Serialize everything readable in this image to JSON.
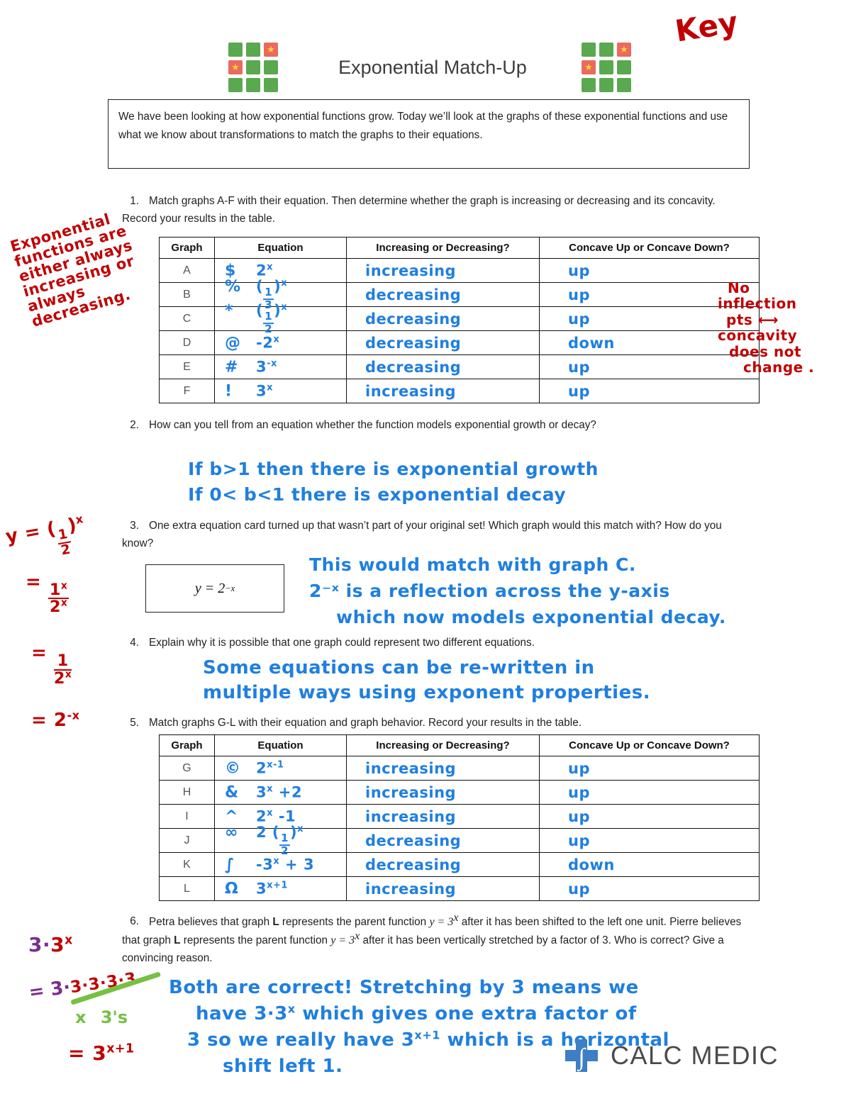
{
  "header": {
    "title": "Exponential Match-Up",
    "key_mark": "Key",
    "logo_icon_name": "match-tiles-logo",
    "star_glyph": "★"
  },
  "intro": {
    "text": "We have been looking at how exponential functions grow. Today we’ll look at the graphs of these exponential functions and use what we know about transformations to match the graphs to their equations."
  },
  "questions": {
    "q1": {
      "number": "1.",
      "text": "Match graphs A-F with their equation. Then determine whether the graph is increasing or decreasing and its concavity. Record your results in the table."
    },
    "q2": {
      "number": "2.",
      "text": "How can you tell from an equation whether the function models exponential growth or decay?",
      "answer_line1": "If b>1 then there is exponential growth",
      "answer_line2": "If 0< b<1 there is exponential decay"
    },
    "q3": {
      "number": "3.",
      "text": "One extra equation card turned up that wasn’t part of your original set! Which graph would this match with? How do you know?",
      "card_equation": "y = 2",
      "card_exponent": "−x",
      "answer_line1": "This would match with graph C.",
      "answer_line2": "2⁻ˣ is a reflection across the y-axis",
      "answer_line3": "which now models exponential decay."
    },
    "q4": {
      "number": "4.",
      "text": "Explain why it is possible that one graph could represent two different equations.",
      "answer_line1": "Some equations can be re-written in",
      "answer_line2": "multiple ways using exponent properties."
    },
    "q5": {
      "number": "5.",
      "text": "Match graphs G-L with their equation and graph behavior. Record your results in the table."
    },
    "q6": {
      "number": "6.",
      "text_a": "Petra believes that graph ",
      "text_b": "L",
      "text_c": " represents the parent function ",
      "text_d": "y = 3",
      "text_e": "x",
      "text_f": " after it has been shifted to the left one unit. Pierre believes that graph ",
      "text_g": "L",
      "text_h": " represents the parent function ",
      "text_i": "y = 3",
      "text_j": "x",
      "text_k": " after it has been vertically stretched by a factor of 3. Who is correct? Give a convincing reason.",
      "answer_line1": "Both are correct! Stretching by 3 means we",
      "answer_line2a": "have   3·3",
      "answer_line2b": "x",
      "answer_line2c": "  which gives one extra factor of",
      "answer_line3a": "3 so we really have  3",
      "answer_line3b": "x+1",
      "answer_line3c": " which is a horizontal",
      "answer_line4": "shift left 1."
    }
  },
  "table1": {
    "headers": [
      "Graph",
      "Equation",
      "Increasing or Decreasing?",
      "Concave Up or Concave Down?"
    ],
    "rows": [
      {
        "graph": "A",
        "eq_symbol": "$",
        "eq_base": "2",
        "eq_sup": "x",
        "eq_frac": null,
        "increasing": "increasing",
        "concavity": "up"
      },
      {
        "graph": "B",
        "eq_symbol": "%",
        "eq_base": null,
        "eq_sup": "x",
        "eq_frac": {
          "num": "1",
          "den": "3"
        },
        "increasing": "decreasing",
        "concavity": "up"
      },
      {
        "graph": "C",
        "eq_symbol": "*",
        "eq_base": null,
        "eq_sup": "x",
        "eq_frac": {
          "num": "1",
          "den": "2"
        },
        "increasing": "decreasing",
        "concavity": "up"
      },
      {
        "graph": "D",
        "eq_symbol": "@",
        "eq_base": "-2",
        "eq_sup": "x",
        "eq_frac": null,
        "increasing": "decreasing",
        "concavity": "down"
      },
      {
        "graph": "E",
        "eq_symbol": "#",
        "eq_base": "3",
        "eq_sup": "-x",
        "eq_frac": null,
        "increasing": "decreasing",
        "concavity": "up"
      },
      {
        "graph": "F",
        "eq_symbol": "!",
        "eq_base": "3",
        "eq_sup": "x",
        "eq_frac": null,
        "increasing": "increasing",
        "concavity": "up"
      }
    ]
  },
  "table2": {
    "headers": [
      "Graph",
      "Equation",
      "Increasing or Decreasing?",
      "Concave Up or Concave Down?"
    ],
    "rows": [
      {
        "graph": "G",
        "eq_symbol": "©",
        "eq_base": "2",
        "eq_sup": "x-1",
        "eq_tail": "",
        "eq_frac": null,
        "increasing": "increasing",
        "concavity": "up"
      },
      {
        "graph": "H",
        "eq_symbol": "&",
        "eq_base": "3",
        "eq_sup": "x",
        "eq_tail": "+2",
        "eq_frac": null,
        "increasing": "increasing",
        "concavity": "up"
      },
      {
        "graph": "I",
        "eq_symbol": "^",
        "eq_base": "2",
        "eq_sup": "x",
        "eq_tail": "-1",
        "eq_frac": null,
        "increasing": "increasing",
        "concavity": "up"
      },
      {
        "graph": "J",
        "eq_symbol": "∞",
        "eq_base": "2",
        "eq_sup": "x",
        "eq_tail": "",
        "eq_frac": {
          "num": "1",
          "den": "2"
        },
        "increasing": "decreasing",
        "concavity": "up"
      },
      {
        "graph": "K",
        "eq_symbol": "∫",
        "eq_base": "-3",
        "eq_sup": "x",
        "eq_tail": "+ 3",
        "eq_frac": null,
        "increasing": "decreasing",
        "concavity": "down"
      },
      {
        "graph": "L",
        "eq_symbol": "Ω",
        "eq_base": "3",
        "eq_sup": "x+1",
        "eq_tail": "",
        "eq_frac": null,
        "increasing": "increasing",
        "concavity": "up"
      }
    ]
  },
  "annotations": {
    "left_top": {
      "line1": "Exponential",
      "line2": "functions are",
      "line3": "either always",
      "line4": "increasing or",
      "line5": "always",
      "line6": "decreasing."
    },
    "right_table1": {
      "line1": "No",
      "line2": "inflection",
      "line3": "pts",
      "arrow": "⟷",
      "line4": "concavity",
      "line5": "does not",
      "line6": "change ."
    },
    "left_mid": {
      "line1_a": "y = (",
      "line1_frac_num": "1",
      "line1_frac_den": "2",
      "line1_b": ")",
      "line1_sup": "x",
      "line2_eq": "=",
      "line2_num": "1",
      "line2_num_sup": "x",
      "line2_den": "2",
      "line2_den_sup": "x",
      "line3_eq": "=",
      "line3_num": "1",
      "line3_den": "2",
      "line3_den_sup": "x",
      "line4_eq": "=",
      "line4_val": "2",
      "line4_sup": "-x"
    },
    "left_bottom": {
      "line1_a": "3·",
      "line1_b": "3",
      "line1_sup": "x",
      "line2_a": "= 3·",
      "line2_b": "3·3·3·3",
      "brace_label_a": "x",
      "brace_label_b": "3's",
      "line3_a": "= 3",
      "line3_sup": "x+1"
    }
  },
  "footer": {
    "brand": "CALC MEDIC",
    "logo_icon_name": "calc-medic-cross-integral-logo",
    "integral_glyph": "∫"
  },
  "colors": {
    "blue_ink": "#1f7fe0",
    "red_ink": "#c00000",
    "purple_ink": "#7b2d90",
    "green_ink": "#76c043",
    "tile_green": "#5aa84f",
    "tile_red": "#ea6a5c",
    "star_yellow": "#f7d13c",
    "brand_gray": "#4a4a4a"
  }
}
